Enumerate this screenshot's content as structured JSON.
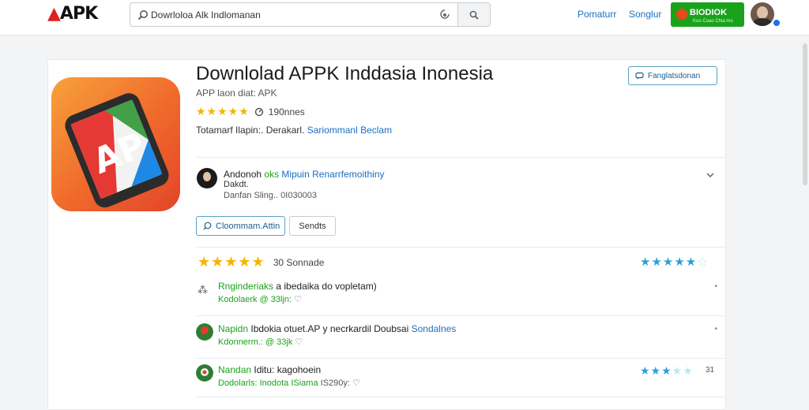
{
  "header": {
    "logo": "APK",
    "search_value": "Dowrloloa Alk Indlomanan",
    "nav": [
      "Pomaturr",
      "Songlur"
    ],
    "download_label": "BIODIOK",
    "download_sub": "Koo Coao Chia mo"
  },
  "app": {
    "title": "Downlolad APPK Inddasia Inonesia",
    "subtitle": "APP laon diat: APK",
    "stars": "★★★★★",
    "rating_count": "190nnes",
    "meta_text": "Totamarf Ilapin:. Derakarl.",
    "meta_link": "Sariommanl Beclam",
    "follow_label": "Fanglatsdonan"
  },
  "developer": {
    "name_plain": "Andonoh",
    "name_green": "oks",
    "name_blue": "Mipuin Renarrfemoithiny",
    "line2": "Dakdt.",
    "line3": "Danfan Sling.. 0I030003"
  },
  "actions": {
    "primary": "Cloommam.Attin",
    "secondary": "Sendts"
  },
  "reviews_summary": {
    "stars": "★★★★★",
    "count": "30 Sonnade",
    "right_stars": "★★★★★",
    "right_light": "☆"
  },
  "reviews": [
    {
      "line1_green": "Rnginderiaks",
      "line1_plain": " a ibedaika do vopletam)",
      "line1_blue": "",
      "line2_green": "Kodolaerk @ 33ljn",
      "line2_plain": ":  ♡",
      "more": "•",
      "stars": "",
      "light": "",
      "count": "",
      "avatar_color": "#d8d8d8"
    },
    {
      "line1_green": "Napidn",
      "line1_plain": " Ibdokia otuet.AP y necrkardil Doubsai ",
      "line1_blue": "Sondalnes",
      "line2_green": "Kdonnerm.: @ 33jk",
      "line2_plain": "  ♡",
      "more": "•",
      "stars": "",
      "light": "",
      "count": "",
      "avatar_color": "#2e7d32"
    },
    {
      "line1_green": "Nandan",
      "line1_plain": " Iditu: kagohoein",
      "line1_blue": "",
      "line2_green": "Dodolarls: Inodota ISiama",
      "line2_plain": " IS290y: ♡",
      "more": "",
      "stars": "★★★",
      "light": "★★",
      "count": "31",
      "avatar_color": "#2e7d32"
    }
  ],
  "colors": {
    "accent_green": "#1aa31a",
    "link_blue": "#1a6fbf",
    "star_gold": "#f4b400",
    "star_blue": "#2aa0d8",
    "brand_red": "#e02020"
  }
}
